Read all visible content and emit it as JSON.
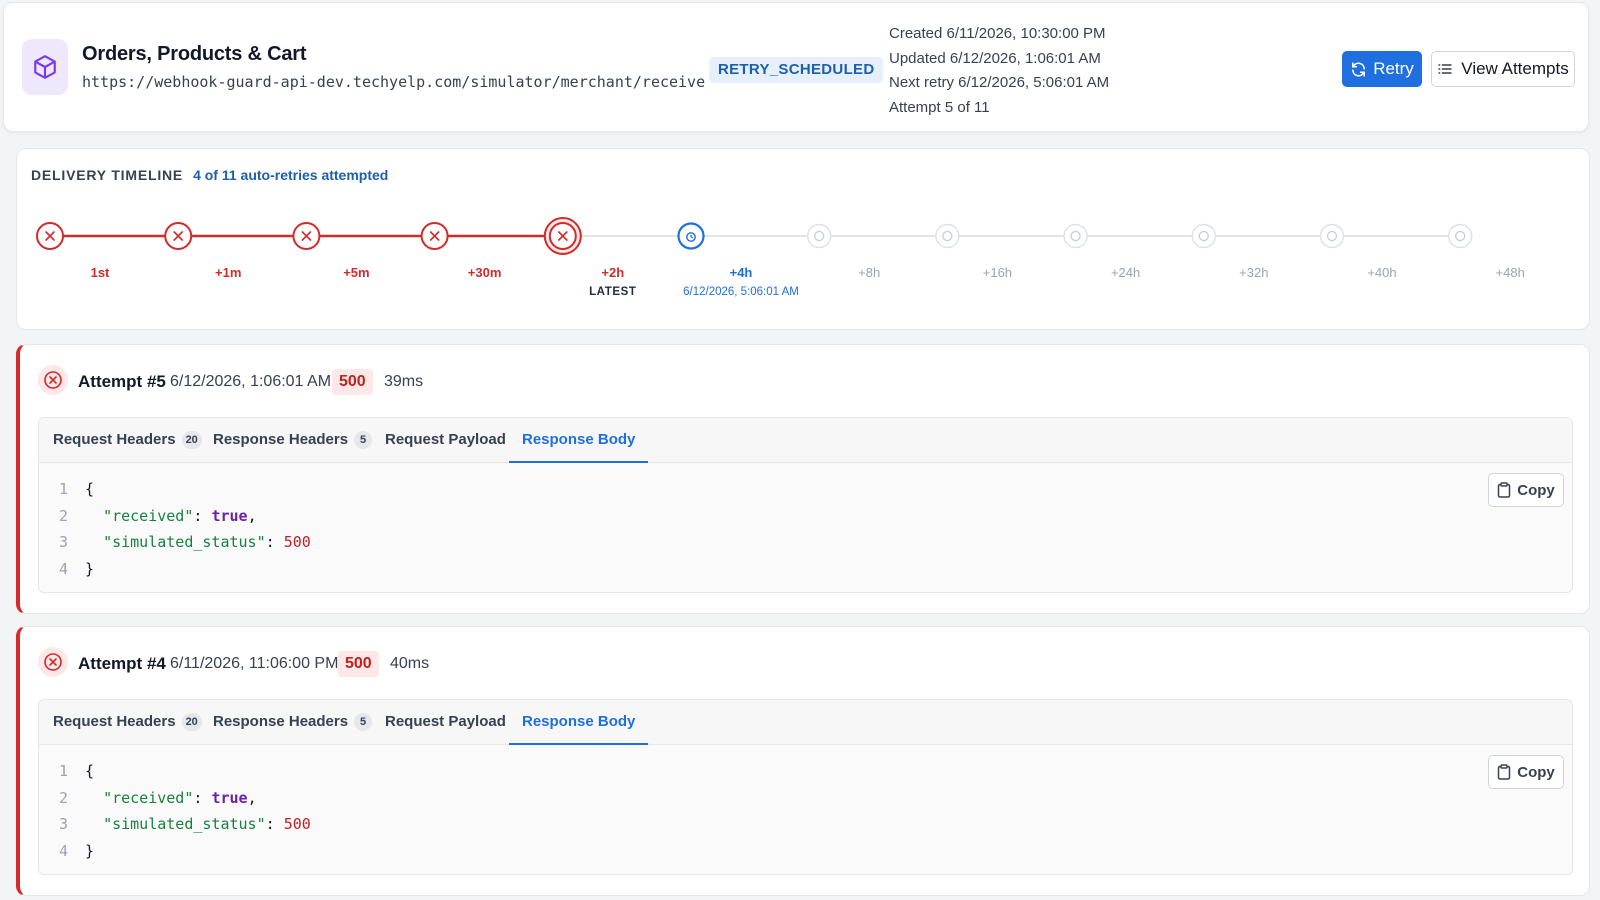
{
  "endpoint": {
    "name": "Orders, Products & Cart",
    "url": "https://webhook-guard-api-dev.techyelp.com/simulator/merchant/receive",
    "status": "RETRY_SCHEDULED",
    "created": "Created 6/11/2026, 10:30:00 PM",
    "updated": "Updated 6/12/2026, 1:06:01 AM",
    "next_retry": "Next retry 6/12/2026, 5:06:01 AM",
    "attempt_of": "Attempt 5 of 11"
  },
  "actions": {
    "retry": "Retry",
    "view_attempts": "View Attempts"
  },
  "timeline": {
    "label": "DELIVERY TIMELINE",
    "summary": "4 of 11 auto-retries attempted",
    "latest_label": "LATEST",
    "next_time": "6/12/2026, 5:06:01 AM",
    "steps": [
      {
        "label": "1st",
        "state": "failed"
      },
      {
        "label": "+1m",
        "state": "failed"
      },
      {
        "label": "+5m",
        "state": "failed"
      },
      {
        "label": "+30m",
        "state": "failed"
      },
      {
        "label": "+2h",
        "state": "latest"
      },
      {
        "label": "+4h",
        "state": "scheduled"
      },
      {
        "label": "+8h",
        "state": "pending"
      },
      {
        "label": "+16h",
        "state": "pending"
      },
      {
        "label": "+24h",
        "state": "pending"
      },
      {
        "label": "+32h",
        "state": "pending"
      },
      {
        "label": "+40h",
        "state": "pending"
      },
      {
        "label": "+48h",
        "state": "pending"
      }
    ]
  },
  "tabs": {
    "request_headers": "Request Headers",
    "request_headers_count": "20",
    "response_headers": "Response Headers",
    "response_headers_count": "5",
    "request_payload": "Request Payload",
    "response_body": "Response Body"
  },
  "copy_label": "Copy",
  "attempts": [
    {
      "title": "Attempt #5",
      "time": "6/12/2026, 1:06:01 AM",
      "code": "500",
      "duration": "39ms",
      "body": {
        "received_key": "\"received\"",
        "received_val": "true",
        "status_key": "\"simulated_status\"",
        "status_val": "500"
      }
    },
    {
      "title": "Attempt #4",
      "time": "6/11/2026, 11:06:00 PM",
      "code": "500",
      "duration": "40ms",
      "body": {
        "received_key": "\"received\"",
        "received_val": "true",
        "status_key": "\"simulated_status\"",
        "status_val": "500"
      }
    }
  ],
  "colors": {
    "accent": "#1f6fe0",
    "failed": "#d42a2a",
    "pending": "#c7ccd3",
    "brand_icon_bg": "#efe7fb",
    "brand_icon": "#7c3aed"
  }
}
